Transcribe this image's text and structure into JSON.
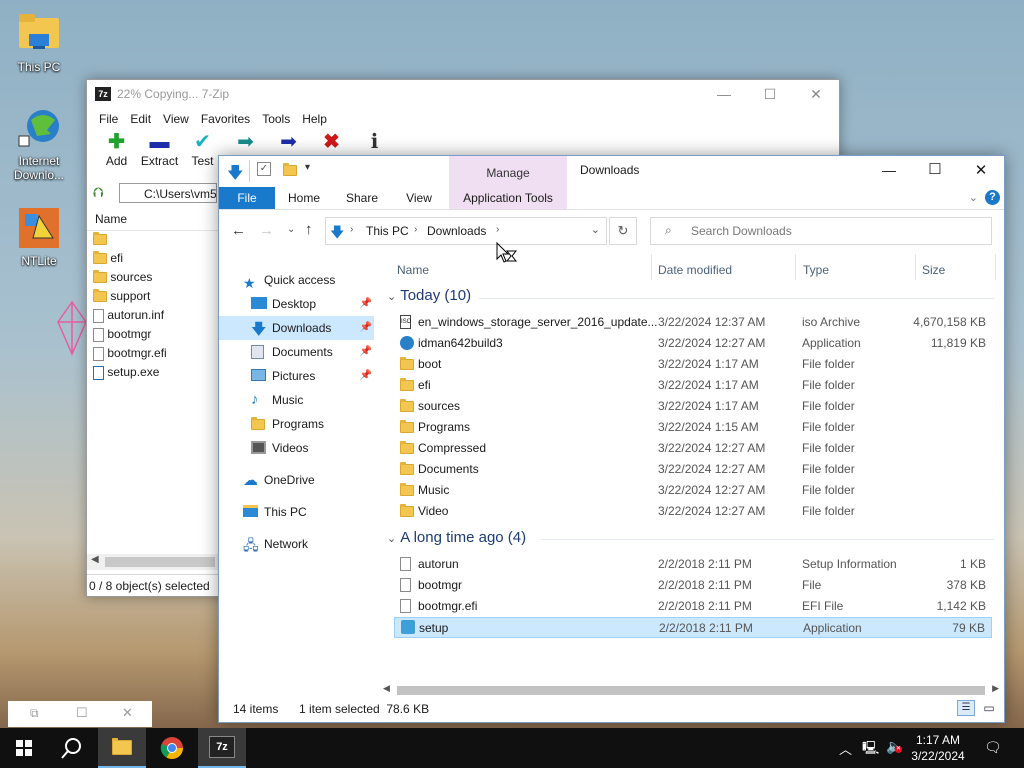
{
  "desktop": {
    "icons": [
      {
        "label": "This PC"
      },
      {
        "label": "Internet Downlo..."
      },
      {
        "label": "NTLite"
      }
    ]
  },
  "zip": {
    "title": "22% Copying... 7-Zip",
    "menu": [
      "File",
      "Edit",
      "View",
      "Favorites",
      "Tools",
      "Help"
    ],
    "toolbar": [
      "Add",
      "Extract",
      "Test"
    ],
    "path": "C:\\Users\\vm5\\",
    "column": "Name",
    "items": [
      "",
      "efi",
      "sources",
      "support",
      "autorun.inf",
      "bootmgr",
      "bootmgr.efi",
      "setup.exe"
    ],
    "status": "0 / 8 object(s) selected"
  },
  "explorer": {
    "title": "Downloads",
    "manage_tab": "Manage",
    "ribbon_tabs": [
      "File",
      "Home",
      "Share",
      "View",
      "Application Tools"
    ],
    "breadcrumb": [
      "This PC",
      "Downloads"
    ],
    "search_placeholder": "Search Downloads",
    "columns": [
      "Name",
      "Date modified",
      "Type",
      "Size"
    ],
    "nav": [
      {
        "label": "Quick access"
      },
      {
        "label": "Desktop"
      },
      {
        "label": "Downloads"
      },
      {
        "label": "Documents"
      },
      {
        "label": "Pictures"
      },
      {
        "label": "Music"
      },
      {
        "label": "Programs"
      },
      {
        "label": "Videos"
      },
      {
        "label": "OneDrive"
      },
      {
        "label": "This PC"
      },
      {
        "label": "Network"
      }
    ],
    "groups": [
      {
        "label": "Today (10)",
        "rows": [
          {
            "name": "en_windows_storage_server_2016_update...",
            "date": "3/22/2024 12:37 AM",
            "type": "iso Archive",
            "size": "4,670,158 KB"
          },
          {
            "name": "idman642build3",
            "date": "3/22/2024 12:27 AM",
            "type": "Application",
            "size": "11,819 KB"
          },
          {
            "name": "boot",
            "date": "3/22/2024 1:17 AM",
            "type": "File folder",
            "size": ""
          },
          {
            "name": "efi",
            "date": "3/22/2024 1:17 AM",
            "type": "File folder",
            "size": ""
          },
          {
            "name": "sources",
            "date": "3/22/2024 1:17 AM",
            "type": "File folder",
            "size": ""
          },
          {
            "name": "Programs",
            "date": "3/22/2024 1:15 AM",
            "type": "File folder",
            "size": ""
          },
          {
            "name": "Compressed",
            "date": "3/22/2024 12:27 AM",
            "type": "File folder",
            "size": ""
          },
          {
            "name": "Documents",
            "date": "3/22/2024 12:27 AM",
            "type": "File folder",
            "size": ""
          },
          {
            "name": "Music",
            "date": "3/22/2024 12:27 AM",
            "type": "File folder",
            "size": ""
          },
          {
            "name": "Video",
            "date": "3/22/2024 12:27 AM",
            "type": "File folder",
            "size": ""
          }
        ]
      },
      {
        "label": "A long time ago (4)",
        "rows": [
          {
            "name": "autorun",
            "date": "2/2/2018 2:11 PM",
            "type": "Setup Information",
            "size": "1 KB"
          },
          {
            "name": "bootmgr",
            "date": "2/2/2018 2:11 PM",
            "type": "File",
            "size": "378 KB"
          },
          {
            "name": "bootmgr.efi",
            "date": "2/2/2018 2:11 PM",
            "type": "EFI File",
            "size": "1,142 KB"
          },
          {
            "name": "setup",
            "date": "2/2/2018 2:11 PM",
            "type": "Application",
            "size": "79 KB"
          }
        ]
      }
    ],
    "status_items": "14 items",
    "status_selected": "1 item selected  78.6 KB"
  },
  "taskbar": {
    "time": "1:17 AM",
    "date": "3/22/2024",
    "zip_label": "7z"
  },
  "colors": {
    "accent": "#1979ca",
    "selection": "#cce8ff",
    "manage_tab": "#f0dff2"
  }
}
